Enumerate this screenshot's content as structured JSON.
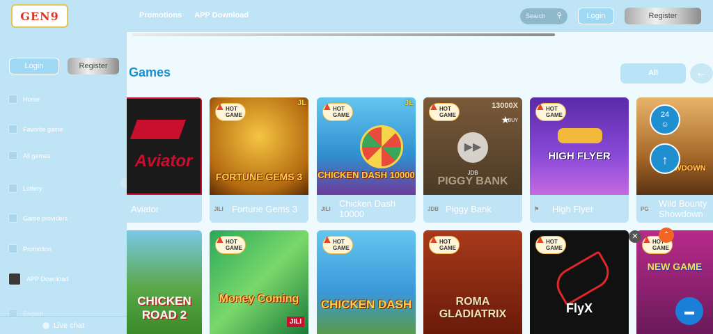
{
  "header": {
    "logo_text": "GEN9",
    "nav": [
      "Promotions",
      "APP Download"
    ],
    "search_placeholder": "Search",
    "login": "Login",
    "register": "Register"
  },
  "sidebar": {
    "login": "Login",
    "register": "Register",
    "items": [
      "Home",
      "Favorite game",
      "All games",
      "Lottery",
      "Game providers",
      "Promotion",
      "APP Download",
      "English"
    ],
    "live_chat": "Live chat"
  },
  "games_section": {
    "title": "Games",
    "filter": "All"
  },
  "badges": {
    "hot_1": "HOT",
    "hot_2": "GAME",
    "jl": "JL",
    "jdb": "JDB",
    "jili_logo": "JILI",
    "buy": "BUY",
    "multiplier": "13000X",
    "flyx": "FlyX"
  },
  "games_row1": [
    {
      "name": "Aviator",
      "provider": "",
      "art": "Aviator"
    },
    {
      "name": "Fortune Gems 3",
      "provider": "JILI",
      "art": "FORTUNE GEMS 3"
    },
    {
      "name": "Chicken Dash 10000",
      "provider": "JILI",
      "art": "CHICKEN DASH 10000"
    },
    {
      "name": "Piggy Bank",
      "provider": "JDB",
      "art": "PIGGY BANK"
    },
    {
      "name": "High Flyer",
      "provider": "",
      "art": "HIGH FLYER"
    },
    {
      "name": "Wild Bounty Showdown",
      "provider": "PG",
      "art": "SHOWDOWN"
    }
  ],
  "games_row2": [
    {
      "art": "CHICKEN ROAD 2"
    },
    {
      "art": "Money Coming"
    },
    {
      "art": "CHICKEN DASH"
    },
    {
      "art": "ROMA GLADIATRIX"
    },
    {
      "art": "FlyX"
    },
    {
      "art": "NEW GAME"
    }
  ],
  "colors": {
    "accent": "#1b90d0",
    "sidebar": "#bfe4f6",
    "background": "#eefafe"
  }
}
